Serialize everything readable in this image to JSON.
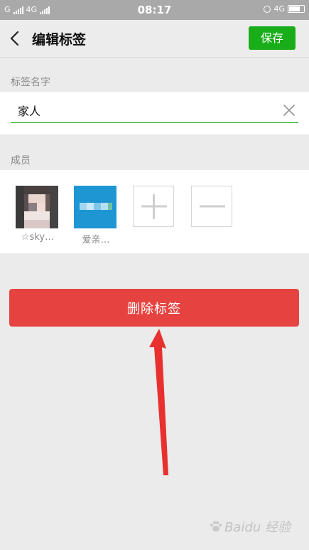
{
  "status_bar": {
    "carrier1": "G",
    "carrier2": "4G",
    "time": "08:17",
    "network_right": "4G"
  },
  "header": {
    "title": "编辑标签",
    "save_label": "保存"
  },
  "tag_name": {
    "section_label": "标签名字",
    "value": "家人"
  },
  "members": {
    "section_label": "成员",
    "items": [
      {
        "name": "☆sky…"
      },
      {
        "name": "爱亲…"
      }
    ]
  },
  "delete_label": "删除标签",
  "watermark": "Baidu 经验",
  "colors": {
    "accent_green": "#19ad19",
    "danger_red": "#e64340",
    "arrow_red": "#e8312f"
  }
}
